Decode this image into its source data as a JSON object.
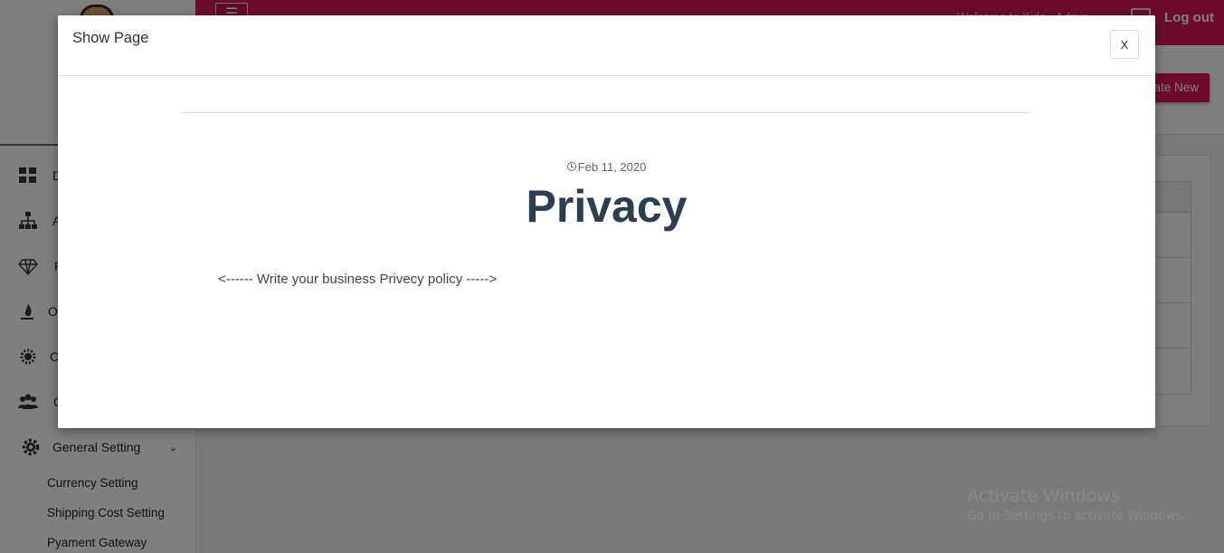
{
  "sidebar": {
    "items": [
      {
        "label": "D",
        "icon": "dashboard-icon"
      },
      {
        "label": "A",
        "icon": "sitemap-icon"
      },
      {
        "label": "P",
        "icon": "diamond-icon"
      },
      {
        "label": "O",
        "icon": "fire-icon"
      },
      {
        "label": "O",
        "icon": "cog-wheel-icon"
      },
      {
        "label": "C",
        "icon": "users-icon"
      },
      {
        "label": "General Setting",
        "icon": "gear-icon"
      }
    ],
    "sub_items": [
      "Currency Setting",
      "Shipping Cost Setting",
      "Pyament Gateway"
    ]
  },
  "topbar": {
    "welcome": "Welcome to Kido - Admin",
    "logout_label": "Log out",
    "brand_color": "#d8165a"
  },
  "subheader": {
    "create_label": "Create New"
  },
  "watermark": {
    "title": "Activate Windows",
    "subtitle": "Go to Settings to activate Windows."
  },
  "modal": {
    "title": "Show Page",
    "close_label": "X",
    "date": "Feb 11, 2020",
    "heading": "Privacy",
    "body": "<------ Write your business Privecy policy ----->"
  }
}
